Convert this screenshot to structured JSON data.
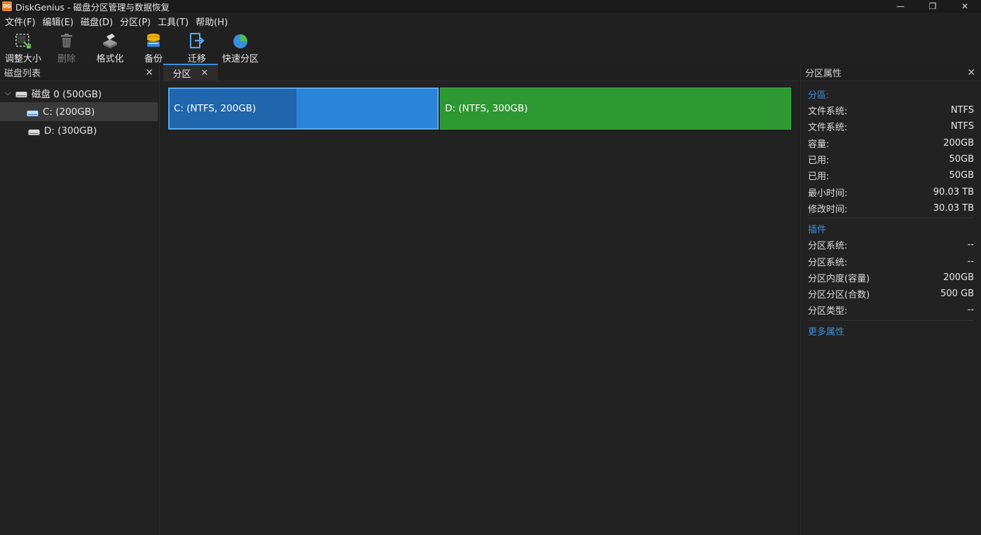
{
  "titlebar": {
    "app_badge": "DG",
    "title": "DiskGenius - 磁盘分区管理与数据恢复",
    "minimize": "—",
    "restore": "❐",
    "close": "✕"
  },
  "menu": [
    "文件(F)",
    "编辑(E)",
    "磁盘(D)",
    "分区(P)",
    "工具(T)",
    "帮助(H)"
  ],
  "toolbar": {
    "resize": "调整大小",
    "delete": "删除",
    "format": "格式化",
    "backup": "备份",
    "migrate": "迁移",
    "quick_partition": "快速分区"
  },
  "left_panel": {
    "title": "磁盘列表",
    "close": "✕",
    "disk": "磁盘 0 (500GB)",
    "partitions": [
      "C: (200GB)",
      "D: (300GB)"
    ]
  },
  "center": {
    "tab_label": "分区",
    "tab_close": "✕",
    "partition_c": {
      "label": "C: (NTFS, 200GB)",
      "capacity_gb": 200,
      "used_gb": 50,
      "color": "#2a84d8",
      "used_color": "#1f66ad"
    },
    "partition_d": {
      "label": "D: (NTFS, 300GB)",
      "capacity_gb": 300,
      "color": "#2e9832"
    }
  },
  "right_panel": {
    "title": "分区属性",
    "close": "✕",
    "section1": {
      "title": "分區:",
      "rows": [
        {
          "key": "文件系统:",
          "value": "NTFS"
        },
        {
          "key": "文件系统:",
          "value": "NTFS"
        },
        {
          "key": "容量:",
          "value": "200GB"
        },
        {
          "key": "已用:",
          "value": "50GB"
        },
        {
          "key": "已用:",
          "value": "50GB"
        },
        {
          "key": "最小时间:",
          "value": "90.03 TB"
        },
        {
          "key": "修改时间:",
          "value": "30.03 TB"
        }
      ]
    },
    "section2": {
      "title": "插件",
      "rows": [
        {
          "key": "分区系统:",
          "value": "--"
        },
        {
          "key": "分区系统:",
          "value": "--"
        },
        {
          "key": "分区内度(容量)",
          "value": "200GB"
        },
        {
          "key": "分区分区(合数)",
          "value": "500 GB"
        },
        {
          "key": "分区类型:",
          "value": "--"
        }
      ]
    },
    "more": "更多属性"
  },
  "colors": {
    "accent": "#3d8fd8",
    "background": "#202020"
  }
}
